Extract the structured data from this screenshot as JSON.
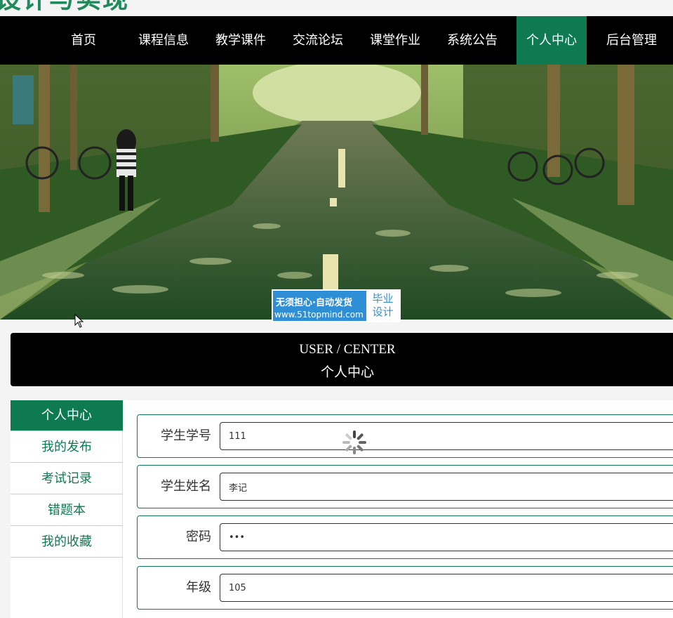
{
  "site": {
    "title": "设计与实现"
  },
  "nav": {
    "items": [
      {
        "label": "首页"
      },
      {
        "label": "课程信息"
      },
      {
        "label": "教学课件"
      },
      {
        "label": "交流论坛"
      },
      {
        "label": "课堂作业"
      },
      {
        "label": "系统公告"
      },
      {
        "label": "个人中心"
      },
      {
        "label": "后台管理"
      }
    ],
    "active_index": 6
  },
  "banner": {
    "watermark": {
      "line1": "无须担心·自动发货",
      "line2": "www.51topmind.com",
      "badge_line1": "毕业",
      "badge_line2": "设计"
    }
  },
  "section": {
    "title_en": "USER / CENTER",
    "title_cn": "个人中心"
  },
  "sidebar": {
    "items": [
      {
        "label": "个人中心"
      },
      {
        "label": "我的发布"
      },
      {
        "label": "考试记录"
      },
      {
        "label": "错题本"
      },
      {
        "label": "我的收藏"
      }
    ],
    "active_index": 0
  },
  "form": {
    "fields": [
      {
        "label": "学生学号",
        "value": "111"
      },
      {
        "label": "学生姓名",
        "value": "李记"
      },
      {
        "label": "密码",
        "value": "•••"
      },
      {
        "label": "年级",
        "value": "105"
      }
    ]
  },
  "colors": {
    "accent": "#0d7a52",
    "nav_bg": "#000000",
    "page_bg": "#f4f4f4"
  }
}
